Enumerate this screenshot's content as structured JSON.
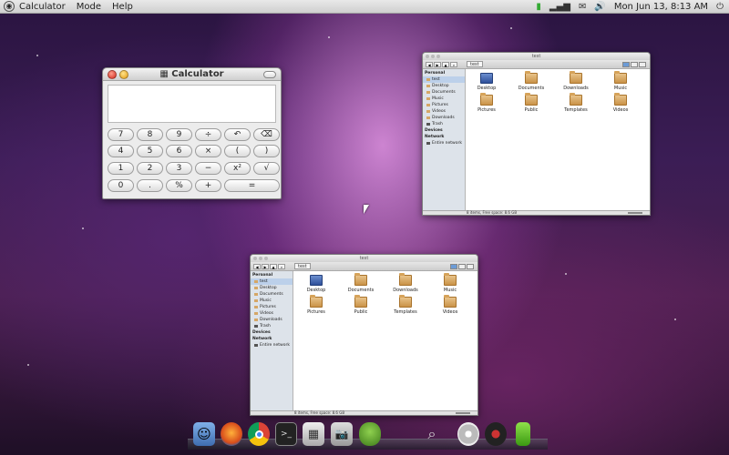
{
  "menubar": {
    "app_name": "Calculator",
    "menus": [
      "Mode",
      "Help"
    ],
    "clock": "Mon Jun 13,  8:13 AM"
  },
  "calculator": {
    "title": "Calculator",
    "display": "",
    "keys": {
      "r1": [
        "7",
        "8",
        "9",
        "÷",
        "↶",
        "⌫"
      ],
      "r2": [
        "4",
        "5",
        "6",
        "×",
        "(",
        ")"
      ],
      "r3": [
        "1",
        "2",
        "3",
        "−",
        "x²",
        "√"
      ],
      "r4": [
        "0",
        ".",
        "%",
        "+",
        "="
      ]
    }
  },
  "file_manager_top": {
    "title": "test",
    "breadcrumb": "test",
    "sidebar": {
      "personal_header": "Personal",
      "personal": [
        "test",
        "Desktop",
        "Documents",
        "Music",
        "Pictures",
        "Videos",
        "Downloads",
        "Trash"
      ],
      "devices_header": "Devices",
      "network_header": "Network",
      "network": [
        "Entire network"
      ]
    },
    "folders": [
      "Desktop",
      "Documents",
      "Downloads",
      "Music",
      "Pictures",
      "Public",
      "Templates",
      "Videos"
    ],
    "status": "8 items, Free space: 8.6 GB"
  },
  "file_manager_bottom": {
    "title": "test",
    "breadcrumb": "test",
    "sidebar": {
      "personal_header": "Personal",
      "personal": [
        "test",
        "Desktop",
        "Documents",
        "Music",
        "Pictures",
        "Videos",
        "Downloads",
        "Trash"
      ],
      "devices_header": "Devices",
      "network_header": "Network",
      "network": [
        "Entire network"
      ]
    },
    "folders": [
      "Desktop",
      "Documents",
      "Downloads",
      "Music",
      "Pictures",
      "Public",
      "Templates",
      "Videos"
    ],
    "status": "8 items, Free space: 8.6 GB"
  },
  "dock": {
    "icons": [
      "finder-icon",
      "firefox-icon",
      "chrome-icon",
      "terminal-icon",
      "calculator-icon",
      "screenshot-icon",
      "pidgin-icon",
      "apple-icon",
      "search-icon",
      "disc-icon",
      "music-icon",
      "battery-icon"
    ]
  }
}
